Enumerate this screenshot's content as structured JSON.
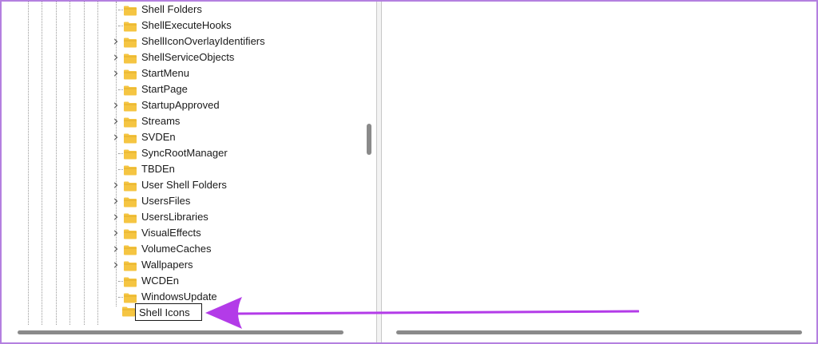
{
  "tree": {
    "items": [
      {
        "label": "Shell Folders",
        "expandable": false
      },
      {
        "label": "ShellExecuteHooks",
        "expandable": false
      },
      {
        "label": "ShellIconOverlayIdentifiers",
        "expandable": true
      },
      {
        "label": "ShellServiceObjects",
        "expandable": true
      },
      {
        "label": "StartMenu",
        "expandable": true
      },
      {
        "label": "StartPage",
        "expandable": false
      },
      {
        "label": "StartupApproved",
        "expandable": true
      },
      {
        "label": "Streams",
        "expandable": true
      },
      {
        "label": "SVDEn",
        "expandable": true
      },
      {
        "label": "SyncRootManager",
        "expandable": false
      },
      {
        "label": "TBDEn",
        "expandable": false
      },
      {
        "label": "User Shell Folders",
        "expandable": true
      },
      {
        "label": "UsersFiles",
        "expandable": true
      },
      {
        "label": "UsersLibraries",
        "expandable": true
      },
      {
        "label": "VisualEffects",
        "expandable": true
      },
      {
        "label": "VolumeCaches",
        "expandable": true
      },
      {
        "label": "Wallpapers",
        "expandable": true
      },
      {
        "label": "WCDEn",
        "expandable": false
      },
      {
        "label": "WindowsUpdate",
        "expandable": false
      }
    ],
    "new_key": {
      "value": "Shell Icons"
    }
  },
  "icons": {
    "folder": "folder-icon",
    "expand": "chevron-right-icon",
    "annotation": "arrow-left-icon"
  },
  "colors": {
    "border": "#b480e0",
    "annotation_arrow": "#b33be8",
    "folder": "#f5c542",
    "scrollbar_thumb": "#8a8a8a"
  }
}
